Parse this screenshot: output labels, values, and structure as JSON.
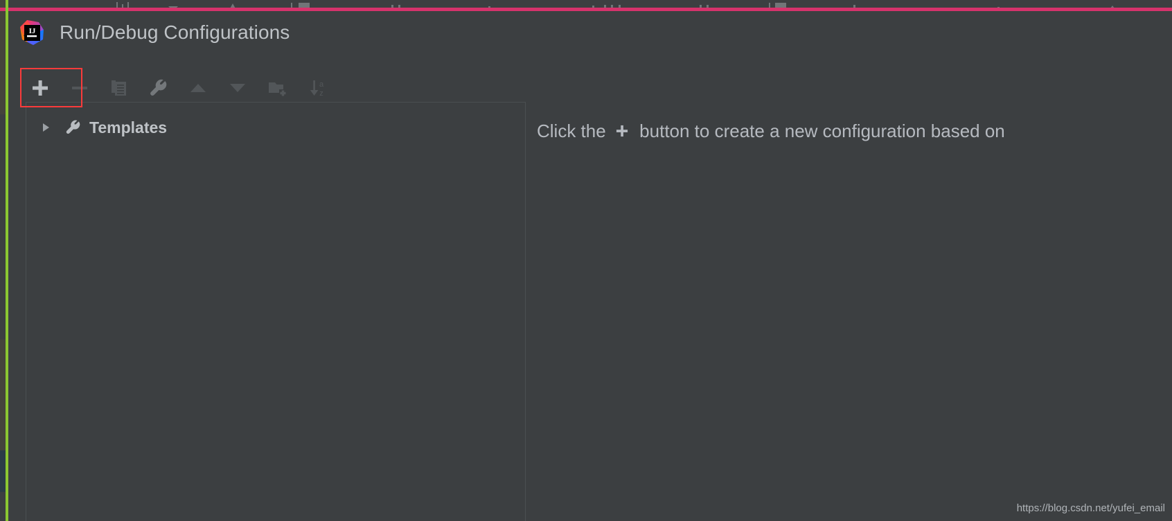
{
  "window": {
    "title": "Run/Debug Configurations",
    "logo_icon": "intellij-idea-logo",
    "background_color": "#3c3f41",
    "accent_border_color": "#d6336c",
    "annotation_color": "#fb3b3b",
    "editor_stripe_color": "#8bc732"
  },
  "toolbar": {
    "buttons": [
      {
        "name": "add-configuration-button",
        "icon": "plus-icon",
        "label": "Add New Configuration",
        "enabled": true,
        "highlighted": true
      },
      {
        "name": "remove-configuration-button",
        "icon": "minus-icon",
        "label": "Remove Configuration",
        "enabled": false,
        "highlighted": false
      },
      {
        "name": "copy-configuration-button",
        "icon": "copy-icon",
        "label": "Copy Configuration",
        "enabled": false,
        "highlighted": false
      },
      {
        "name": "edit-templates-button",
        "icon": "wrench-icon",
        "label": "Edit Templates",
        "enabled": false,
        "highlighted": false
      },
      {
        "name": "move-up-button",
        "icon": "arrow-up-icon",
        "label": "Move Up",
        "enabled": false,
        "highlighted": false
      },
      {
        "name": "move-down-button",
        "icon": "arrow-down-icon",
        "label": "Move Down",
        "enabled": false,
        "highlighted": false
      },
      {
        "name": "new-folder-button",
        "icon": "folder-plus-icon",
        "label": "Create New Folder",
        "enabled": false,
        "highlighted": false
      },
      {
        "name": "sort-configurations-button",
        "icon": "sort-az-icon",
        "label": "Sort Configurations",
        "enabled": false,
        "highlighted": false
      }
    ]
  },
  "tree": {
    "nodes": [
      {
        "label": "Templates",
        "icon": "wrench-icon",
        "expanded": false,
        "toggle_icon": "triangle-right-icon"
      }
    ]
  },
  "detail": {
    "hint_prefix": "Click the",
    "hint_icon": "plus-icon",
    "hint_suffix": "button to create a new configuration based on"
  },
  "watermark": {
    "text": "https://blog.csdn.net/yufei_email"
  }
}
